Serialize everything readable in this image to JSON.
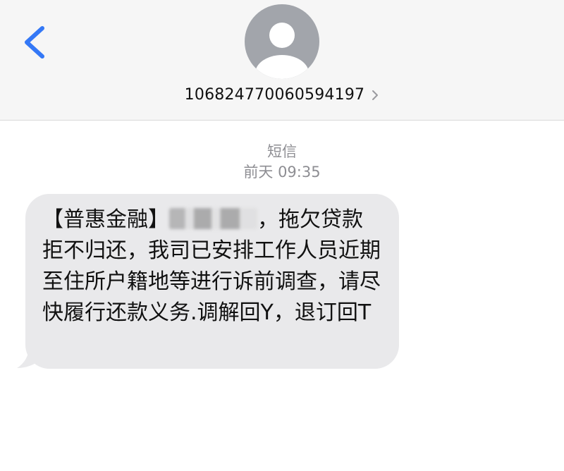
{
  "header": {
    "back_icon": "chevron-left-icon",
    "avatar_icon": "person-icon",
    "sender_number": "106824770060594197",
    "details_icon": "chevron-right-icon"
  },
  "thread": {
    "message_type": "短信",
    "timestamp": "前天 09:35"
  },
  "message": {
    "part1": "【普惠金融】",
    "redacted_name_icon": "blurred-name",
    "part2": "，拖欠贷款拒不归还，我司已安排工作人员近期至住所户籍地等进行诉前调查，请尽快履行还款义务.调解回Y，退订回T"
  },
  "colors": {
    "header_bg": "#f6f6f6",
    "accent_blue": "#3478f6",
    "avatar_gray": "#a2a5ab",
    "bubble_bg": "#e9e9eb",
    "meta_gray": "#8e8e93"
  }
}
